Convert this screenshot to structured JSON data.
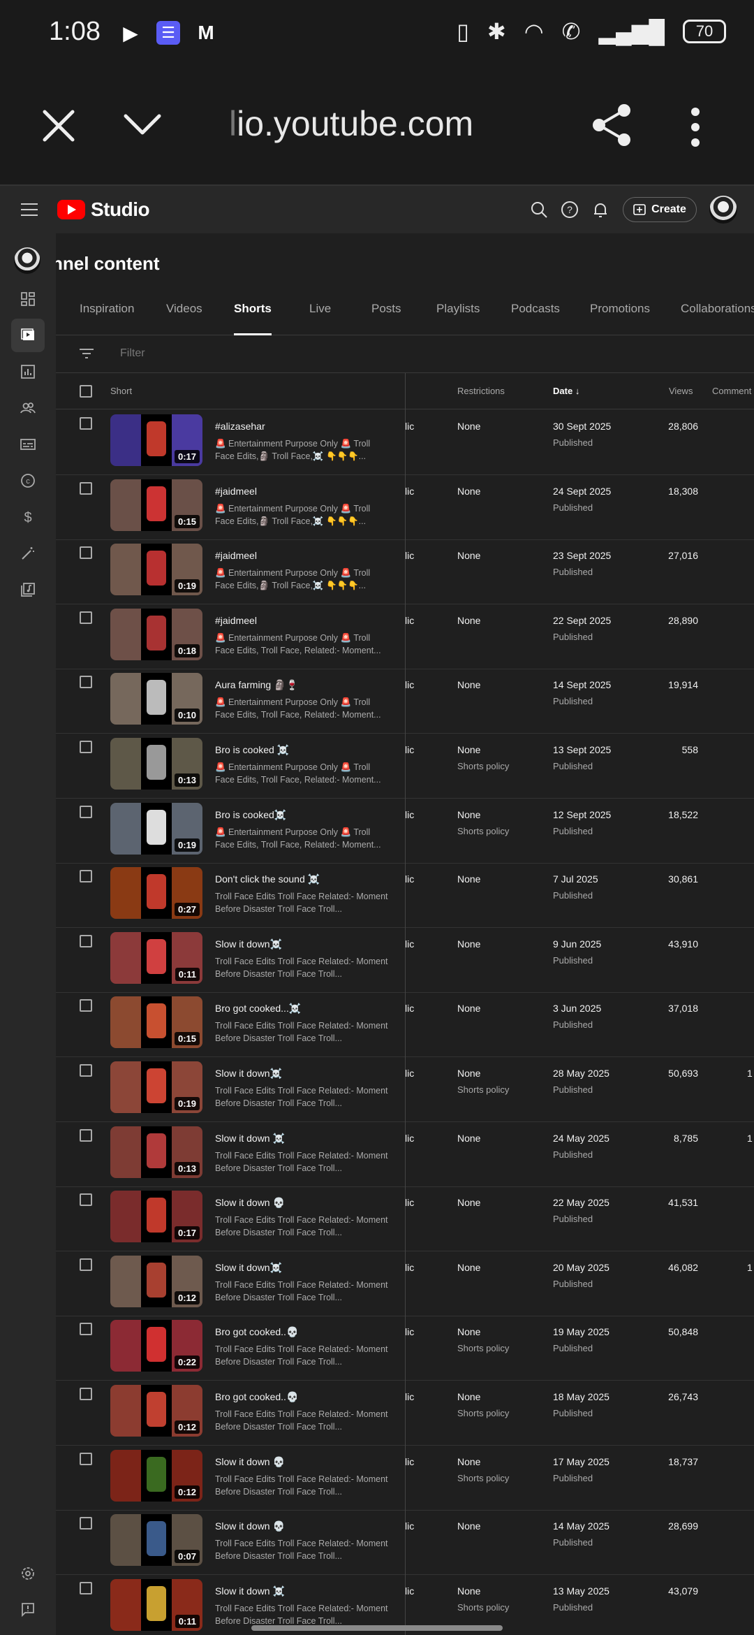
{
  "status_bar": {
    "time": "1:08",
    "app_icons": [
      "play-icon",
      "list-icon",
      "m-icon"
    ],
    "battery": "70"
  },
  "browser": {
    "url_fade": "l",
    "url": "io.youtube.com"
  },
  "header": {
    "logo_text": "Studio",
    "create_label": "Create"
  },
  "page": {
    "title": "nnel content",
    "tabs": [
      "Inspiration",
      "Videos",
      "Shorts",
      "Live",
      "Posts",
      "Playlists",
      "Podcasts",
      "Promotions",
      "Collaborations"
    ],
    "active_tab": "Shorts",
    "filter_placeholder": "Filter"
  },
  "table": {
    "headers": {
      "short": "Short",
      "restrictions": "Restrictions",
      "date": "Date",
      "views": "Views",
      "comments": "Comment"
    },
    "rows": [
      {
        "title": "#alizasehar",
        "desc": "🚨 Entertainment Purpose Only 🚨 Troll Face Edits,🗿 Troll Face,☠️ 👇👇👇...",
        "vis": "lic",
        "restr": "None",
        "restr2": "",
        "date": "30 Sept 2025",
        "status": "Published",
        "views": "28,806",
        "comm": "",
        "duration": "0:17",
        "colL": "#3b2f86",
        "colR": "#4a3aa0",
        "colC": "#c0392b"
      },
      {
        "title": "#jaidmeel",
        "desc": "🚨 Entertainment Purpose Only 🚨 Troll Face Edits,🗿 Troll Face,☠️ 👇👇👇...",
        "vis": "lic",
        "restr": "None",
        "restr2": "",
        "date": "24 Sept 2025",
        "status": "Published",
        "views": "18,308",
        "comm": "",
        "duration": "0:15",
        "colL": "#6a5048",
        "colR": "#6a5048",
        "colC": "#cc3333"
      },
      {
        "title": "#jaidmeel",
        "desc": "🚨 Entertainment Purpose Only 🚨 Troll Face Edits,🗿 Troll Face,☠️ 👇👇👇...",
        "vis": "lic",
        "restr": "None",
        "restr2": "",
        "date": "23 Sept 2025",
        "status": "Published",
        "views": "27,016",
        "comm": "",
        "duration": "0:19",
        "colL": "#70584c",
        "colR": "#70584c",
        "colC": "#b83030"
      },
      {
        "title": "#jaidmeel",
        "desc": "🚨 Entertainment Purpose Only 🚨 Troll Face Edits, Troll Face, Related:- Moment...",
        "vis": "lic",
        "restr": "None",
        "restr2": "",
        "date": "22 Sept 2025",
        "status": "Published",
        "views": "28,890",
        "comm": "",
        "duration": "0:18",
        "colL": "#6e5048",
        "colR": "#6e5048",
        "colC": "#a83232"
      },
      {
        "title": "Aura farming 🗿🍷",
        "desc": "🚨 Entertainment Purpose Only 🚨 Troll Face Edits, Troll Face, Related:- Moment...",
        "vis": "lic",
        "restr": "None",
        "restr2": "",
        "date": "14 Sept 2025",
        "status": "Published",
        "views": "19,914",
        "comm": "",
        "duration": "0:10",
        "colL": "#76685c",
        "colR": "#76685c",
        "colC": "#bbb"
      },
      {
        "title": "Bro is cooked ☠️",
        "desc": "🚨 Entertainment Purpose Only 🚨 Troll Face Edits, Troll Face, Related:- Moment...",
        "vis": "lic",
        "restr": "None",
        "restr2": "Shorts policy",
        "date": "13 Sept 2025",
        "status": "Published",
        "views": "558",
        "comm": "",
        "duration": "0:13",
        "colL": "#5e5848",
        "colR": "#5e5848",
        "colC": "#999"
      },
      {
        "title": "Bro is cooked☠️",
        "desc": "🚨 Entertainment Purpose Only 🚨 Troll Face Edits, Troll Face, Related:- Moment...",
        "vis": "lic",
        "restr": "None",
        "restr2": "Shorts policy",
        "date": "12 Sept 2025",
        "status": "Published",
        "views": "18,522",
        "comm": "",
        "duration": "0:19",
        "colL": "#5c6470",
        "colR": "#5c6470",
        "colC": "#ddd"
      },
      {
        "title": "Don't click the sound ☠️",
        "desc": "Troll Face Edits Troll Face Related:- Moment Before Disaster Troll Face Troll...",
        "vis": "lic",
        "restr": "None",
        "restr2": "",
        "date": "7 Jul 2025",
        "status": "Published",
        "views": "30,861",
        "comm": "",
        "duration": "0:27",
        "colL": "#8a3a14",
        "colR": "#8a3a14",
        "colC": "#c0392b"
      },
      {
        "title": "Slow it down☠️",
        "desc": "Troll Face Edits Troll Face Related:- Moment Before Disaster Troll Face Troll...",
        "vis": "lic",
        "restr": "None",
        "restr2": "",
        "date": "9 Jun 2025",
        "status": "Published",
        "views": "43,910",
        "comm": "",
        "duration": "0:11",
        "colL": "#8c3a3a",
        "colR": "#8c3a3a",
        "colC": "#d04040"
      },
      {
        "title": "Bro got cooked...☠️",
        "desc": "Troll Face Edits Troll Face Related:- Moment Before Disaster Troll Face Troll...",
        "vis": "lic",
        "restr": "None",
        "restr2": "",
        "date": "3 Jun 2025",
        "status": "Published",
        "views": "37,018",
        "comm": "",
        "duration": "0:15",
        "colL": "#8c4a30",
        "colR": "#8c4a30",
        "colC": "#c85030"
      },
      {
        "title": "Slow it down☠️",
        "desc": "Troll Face Edits Troll Face Related:- Moment Before Disaster Troll Face Troll...",
        "vis": "lic",
        "restr": "None",
        "restr2": "Shorts policy",
        "date": "28 May 2025",
        "status": "Published",
        "views": "50,693",
        "comm": "1",
        "duration": "0:19",
        "colL": "#8c4638",
        "colR": "#8c4638",
        "colC": "#cc4433"
      },
      {
        "title": "Slow it down ☠️",
        "desc": "Troll Face Edits Troll Face Related:- Moment Before Disaster Troll Face Troll...",
        "vis": "lic",
        "restr": "None",
        "restr2": "",
        "date": "24 May 2025",
        "status": "Published",
        "views": "8,785",
        "comm": "1",
        "duration": "0:13",
        "colL": "#7e3c34",
        "colR": "#7e3c34",
        "colC": "#b03a3a"
      },
      {
        "title": "Slow it down 💀",
        "desc": "Troll Face Edits Troll Face Related:- Moment Before Disaster Troll Face Troll...",
        "vis": "lic",
        "restr": "None",
        "restr2": "",
        "date": "22 May 2025",
        "status": "Published",
        "views": "41,531",
        "comm": "",
        "duration": "0:17",
        "colL": "#7a2c2c",
        "colR": "#7a2c2c",
        "colC": "#c0392b"
      },
      {
        "title": "Slow it down☠️",
        "desc": "Troll Face Edits Troll Face Related:- Moment Before Disaster Troll Face Troll...",
        "vis": "lic",
        "restr": "None",
        "restr2": "",
        "date": "20 May 2025",
        "status": "Published",
        "views": "46,082",
        "comm": "1",
        "duration": "0:12",
        "colL": "#6e5a4e",
        "colR": "#6e5a4e",
        "colC": "#a84030"
      },
      {
        "title": "Bro got cooked..💀",
        "desc": "Troll Face Edits Troll Face Related:- Moment Before Disaster Troll Face Troll...",
        "vis": "lic",
        "restr": "None",
        "restr2": "Shorts policy",
        "date": "19 May 2025",
        "status": "Published",
        "views": "50,848",
        "comm": "",
        "duration": "0:22",
        "colL": "#8c2a34",
        "colR": "#8c2a34",
        "colC": "#d03030"
      },
      {
        "title": "Bro got cooked..💀",
        "desc": "Troll Face Edits Troll Face Related:- Moment Before Disaster Troll Face Troll...",
        "vis": "lic",
        "restr": "None",
        "restr2": "Shorts policy",
        "date": "18 May 2025",
        "status": "Published",
        "views": "26,743",
        "comm": "",
        "duration": "0:12",
        "colL": "#8c3c30",
        "colR": "#8c3c30",
        "colC": "#c04030"
      },
      {
        "title": "Slow it down 💀",
        "desc": "Troll Face Edits Troll Face Related:- Moment Before Disaster Troll Face Troll...",
        "vis": "lic",
        "restr": "None",
        "restr2": "Shorts policy",
        "date": "17 May 2025",
        "status": "Published",
        "views": "18,737",
        "comm": "",
        "duration": "0:12",
        "colL": "#7c2418",
        "colR": "#7c2418",
        "colC": "#3a6a20"
      },
      {
        "title": "Slow it down 💀",
        "desc": "Troll Face Edits Troll Face Related:- Moment Before Disaster Troll Face Troll...",
        "vis": "lic",
        "restr": "None",
        "restr2": "",
        "date": "14 May 2025",
        "status": "Published",
        "views": "28,699",
        "comm": "",
        "duration": "0:07",
        "colL": "#5c5044",
        "colR": "#5c5044",
        "colC": "#3a5a8a"
      },
      {
        "title": "Slow it down ☠️",
        "desc": "Troll Face Edits Troll Face Related:- Moment Before Disaster Troll Face Troll...",
        "vis": "lic",
        "restr": "None",
        "restr2": "Shorts policy",
        "date": "13 May 2025",
        "status": "Published",
        "views": "43,079",
        "comm": "",
        "duration": "0:11",
        "colL": "#8a2a1a",
        "colR": "#8a2a1a",
        "colC": "#c8a030"
      }
    ]
  }
}
